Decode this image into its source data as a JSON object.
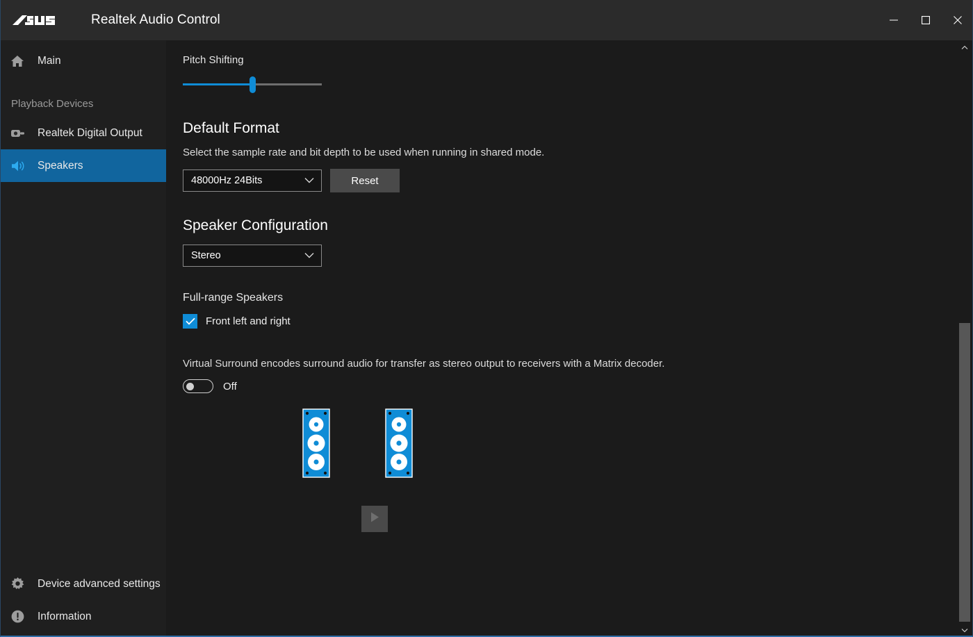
{
  "window": {
    "brand": "ASUS",
    "title": "Realtek Audio Control",
    "controls": {
      "minimize": "minimize-icon",
      "maximize": "maximize-icon",
      "close": "close-icon"
    }
  },
  "sidebar": {
    "top_items": [
      {
        "label": "Main",
        "icon": "home-icon",
        "active": false
      }
    ],
    "section_label": "Playback Devices",
    "devices": [
      {
        "label": "Realtek Digital Output",
        "icon": "spdif-icon",
        "active": false
      },
      {
        "label": "Speakers",
        "icon": "speaker-icon",
        "active": true
      }
    ],
    "bottom_items": [
      {
        "label": "Device advanced settings",
        "icon": "gear-icon"
      },
      {
        "label": "Information",
        "icon": "info-icon"
      }
    ]
  },
  "main": {
    "pitch": {
      "label": "Pitch Shifting",
      "value": 50,
      "min": 0,
      "max": 100
    },
    "default_format": {
      "title": "Default Format",
      "description": "Select the sample rate and bit depth to be used when running in shared mode.",
      "selected": "48000Hz 24Bits",
      "reset_label": "Reset"
    },
    "speaker_configuration": {
      "title": "Speaker Configuration",
      "selected": "Stereo",
      "full_range_label": "Full-range Speakers",
      "full_range_option": "Front left and right",
      "full_range_checked": true,
      "virtual_surround_description": "Virtual Surround encodes surround audio for transfer as stereo output to receivers with a Matrix decoder.",
      "virtual_surround_state": "Off",
      "virtual_surround_on": false,
      "speakers": [
        {
          "name": "front-left-speaker"
        },
        {
          "name": "front-right-speaker"
        }
      ],
      "play_label": "play-icon"
    }
  },
  "scrollbar": {
    "up": "chevron-up-icon",
    "down": "chevron-down-icon"
  },
  "colors": {
    "accent": "#0f8cd6",
    "selection": "#11659e",
    "window_bg": "#1b1b1b",
    "sidebar_bg": "#1f1f1f",
    "titlebar_bg": "#2b2b2b"
  }
}
